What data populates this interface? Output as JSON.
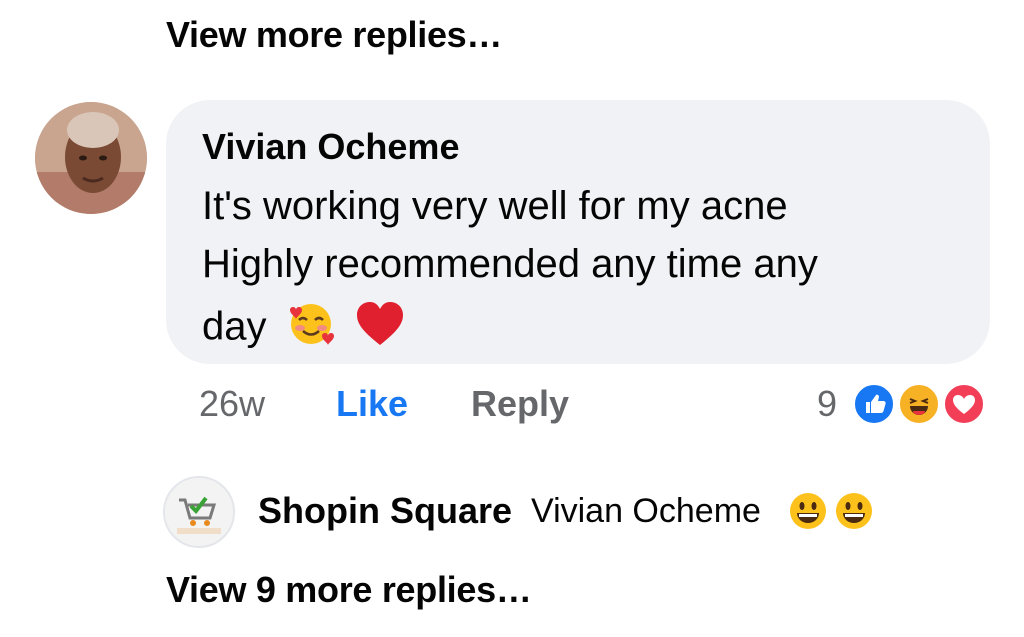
{
  "thread": {
    "view_more_top": "View more replies…",
    "view_more_bottom": "View 9 more replies…"
  },
  "comment": {
    "author": "Vivian Ocheme",
    "text_line1": "It's working very well for my acne",
    "text_line2": "Highly recommended any time any",
    "text_line3": "day",
    "text_emojis": [
      "smiling-face-with-hearts",
      "red-heart"
    ],
    "timestamp": "26w",
    "like_label": "Like",
    "reply_label": "Reply",
    "reaction_count": "9",
    "reactions": [
      "like",
      "haha",
      "love"
    ],
    "colors": {
      "like": "#1877f2",
      "haha": "#f7b125",
      "love": "#f33e58",
      "bubble": "#f0f2f5"
    }
  },
  "reply": {
    "author": "Shopin Square",
    "text": "Vivian Ocheme",
    "emojis": [
      "grinning-face",
      "grinning-face"
    ],
    "avatar_logo_text": "SHOPIN SQUARE"
  }
}
